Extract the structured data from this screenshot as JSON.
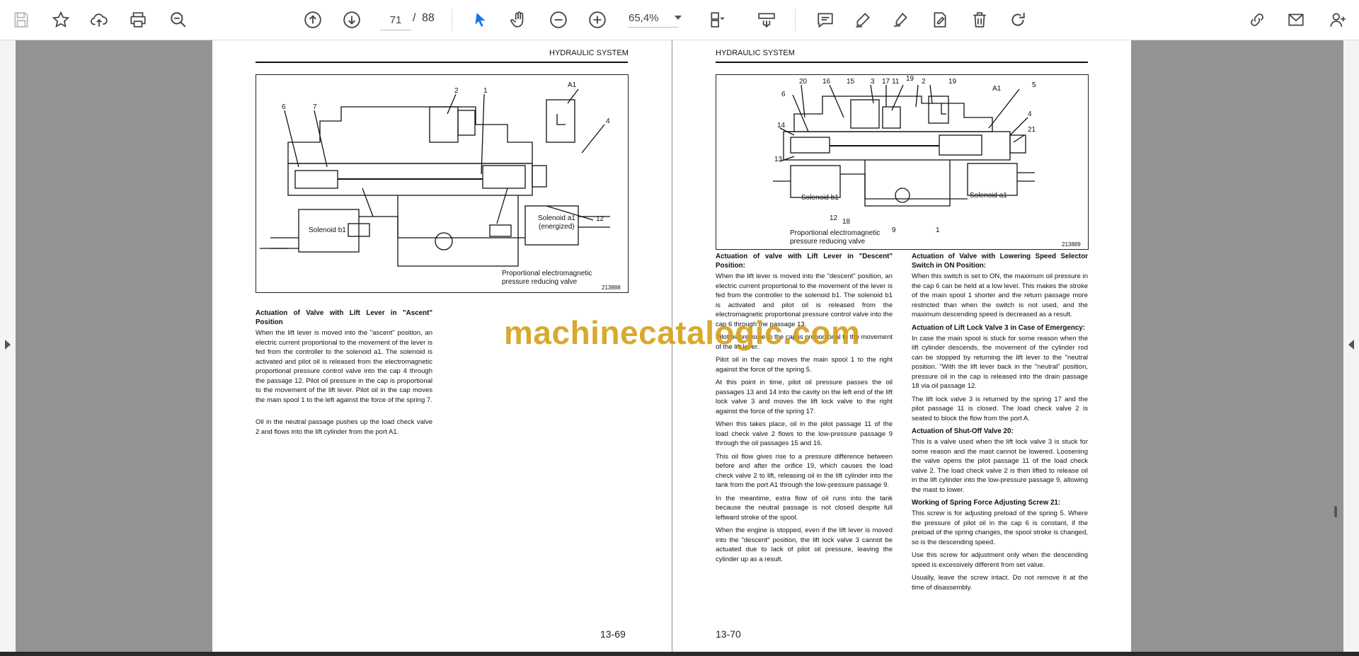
{
  "toolbar": {
    "current_page": "71",
    "page_separator": "/",
    "total_pages": "88",
    "zoom": "65,4%"
  },
  "left_page": {
    "running_head": "HYDRAULIC SYSTEM",
    "figure": {
      "labels": [
        "1",
        "2",
        "A1",
        "4",
        "6",
        "7",
        "12"
      ],
      "solenoid_b1": "Solenoid b1",
      "solenoid_a1_line1": "Solenoid a1",
      "solenoid_a1_line2": "(energized)",
      "caption_line1": "Proportional electromagnetic",
      "caption_line2": "pressure reducing valve",
      "number": "213888"
    },
    "heading": "Actuation of Valve with Lift Lever in \"Ascent\" Position",
    "para1": "When the lift lever is moved into the \"ascent\" position, an electric current proportional to the movement of the lever is fed from the controller to the solenoid a1. The solenoid is activated and pilot oil is released from the electromagnetic proportional pressure control valve into the cap 4 through the passage 12. Pilot oil pressure in the cap is proportional to the movement of the lift lever. Pilot oil in the cap moves the main spool 1 to the left against the force of the spring 7.",
    "para2": "Oil in the neutral passage pushes up the load check valve 2 and flows into the lift cylinder from the port A1.",
    "page_number": "13-69"
  },
  "right_page": {
    "running_head": "HYDRAULIC SYSTEM",
    "figure": {
      "labels": [
        "20",
        "16",
        "15",
        "3",
        "17",
        "11",
        "19",
        "2",
        "19",
        "A1",
        "5",
        "6",
        "4",
        "21",
        "14",
        "13",
        "12",
        "18",
        "9",
        "1"
      ],
      "solenoid_b1": "Solenoid b1",
      "solenoid_a1": "Solenoid a1",
      "caption_line1": "Proportional electromagnetic",
      "caption_line2": "pressure reducing valve",
      "number": "213889"
    },
    "col1": {
      "h1": "Actuation of valve with Lift Lever in \"Descent\" Position:",
      "p1": "When the lift lever is moved into the \"descent\" position, an electric current proportional to the movement of the lever is fed from the controller to the solenoid b1. The solenoid b1 is activated and pilot oil is released from the electromagnetic proportional pressure control valve into the cap 6 through the passage 13.",
      "p2": "Pilot oil pressure in the cap is proportional to the movement of the lift lever.",
      "p3": "Pilot oil in the cap moves the main spool 1 to the right against the force of the spring 5.",
      "p4": "At this point in time, pilot oil pressure passes the oil passages 13 and 14 into the cavity on the left end of the lift lock valve 3 and moves the lift lock valve to the right against the force of the spring 17.",
      "p5": "When this takes place, oil in the pilot passage 11 of the load check valve 2 flows to the low-pressure passage 9 through the oil passages 15 and 16.",
      "p6": "This oil flow gives rise to a pressure difference between before and after the orifice 19, which causes the load check valve 2 to lift, releasing oil in the lift cylinder into the tank from the port A1 through the low-pressure passage 9.",
      "p7": "In the meantime, extra flow of oil runs into the tank because the neutral passage is not closed despite full leftward stroke of the spool.",
      "p8": "When the engine is stopped, even if the lift lever is moved into the \"descent\" position, the lift lock valve 3 cannot be actuated due to lack of pilot oil pressure, leaving the cylinder up as a result."
    },
    "col2": {
      "h1": "Actuation of Valve with Lowering Speed Selector Switch in ON Position:",
      "p1": "When this switch is set to ON, the maximum oil pressure in the cap 6 can be held at a low level. This makes the stroke of the main spool 1 shorter and the return passage more restricted than when the switch is not used, and the maximum descending speed is decreased as a result.",
      "h2": "Actuation of Lift Lock Valve 3 in Case of Emergency:",
      "p2": "In case the main spool is stuck for some reason when the lift cylinder descends, the movement of the cylinder rod can be stopped by returning the lift lever to the \"neutral position. \"With the lift lever back in the \"neutral\" position, pressure oil in the cap is released into the drain passage 18 via oil passage 12.",
      "p3": "The lift lock valve 3 is returned by the spring 17 and the pilot passage 11 is closed. The load check valve 2 is seated to block the flow from the port A.",
      "h3": "Actuation of Shut-Off Valve 20:",
      "p4": "This is a valve used when the lift lock valve 3 is stuck for some reason and the mast cannot be lowered. Loosening the valve opens the pilot passage 11 of the load check valve 2. The load check valve 2 is then lifted to release oil in the lift cylinder into the low-pressure passage 9, allowing the mast to lower.",
      "h4": "Working of Spring Force Adjusting Screw 21:",
      "p5": "This screw is for adjusting preload of the spring 5. Where the pressure of pilot oil in the cap 6 is constant, if the preload of the spring changes, the spool stroke is changed, so is the descending speed.",
      "p6": "Use this screw for adjustment only when the descending speed is excessively different from set value.",
      "p7": "Usually, leave the screw intact. Do not remove it at the time of disassembly."
    },
    "page_number": "13-70"
  },
  "watermark": "machinecatalogic.com"
}
